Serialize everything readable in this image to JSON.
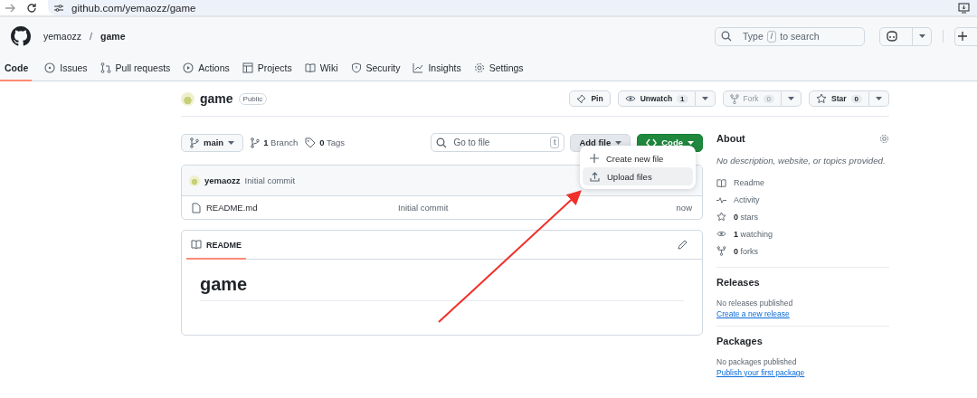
{
  "browser": {
    "url": "github.com/yemaozz/game"
  },
  "header": {
    "owner": "yemaozz",
    "separator": "/",
    "repo": "game",
    "search": {
      "before": "Type",
      "key": "/",
      "after": "to search"
    }
  },
  "nav": [
    {
      "label": "Code",
      "selected": true
    },
    {
      "label": "Issues",
      "selected": false
    },
    {
      "label": "Pull requests",
      "selected": false
    },
    {
      "label": "Actions",
      "selected": false
    },
    {
      "label": "Projects",
      "selected": false
    },
    {
      "label": "Wiki",
      "selected": false
    },
    {
      "label": "Security",
      "selected": false
    },
    {
      "label": "Insights",
      "selected": false
    },
    {
      "label": "Settings",
      "selected": false
    }
  ],
  "repo": {
    "name": "game",
    "visibility": "Public",
    "actions": [
      {
        "kind": "pin",
        "label": "Pin"
      },
      {
        "kind": "watch",
        "label": "Unwatch",
        "count": "1",
        "disabled": false
      },
      {
        "kind": "fork",
        "label": "Fork",
        "count": "0",
        "disabled": true
      },
      {
        "kind": "star",
        "label": "Star",
        "count": "0",
        "disabled": false
      }
    ]
  },
  "toolbar": {
    "branch": "main",
    "branches": "**1** Branch",
    "tags": "**0** Tags",
    "go_to_file": {
      "placeholder": "Go to file",
      "key": "t"
    },
    "add_file": "Add file",
    "code": "Code"
  },
  "add_file_menu": [
    {
      "label": "Create new file",
      "selected": false
    },
    {
      "label": "Upload files",
      "selected": true
    }
  ],
  "commit": {
    "author": "yemaozz",
    "message": "Initial commit"
  },
  "files": [
    {
      "name": "README.md",
      "message": "Initial commit",
      "time": "now"
    }
  ],
  "readme": {
    "tab": "README",
    "heading": "game"
  },
  "about": {
    "title": "About",
    "description": "No description, website, or topics provided.",
    "items": [
      "Readme",
      "Activity",
      "**0** stars",
      "**1** watching",
      "**0** forks"
    ]
  },
  "releases": {
    "title": "Releases",
    "text": "No releases published",
    "link": "Create a new release"
  },
  "packages": {
    "title": "Packages",
    "text": "No packages published",
    "link": "Publish your first package"
  }
}
